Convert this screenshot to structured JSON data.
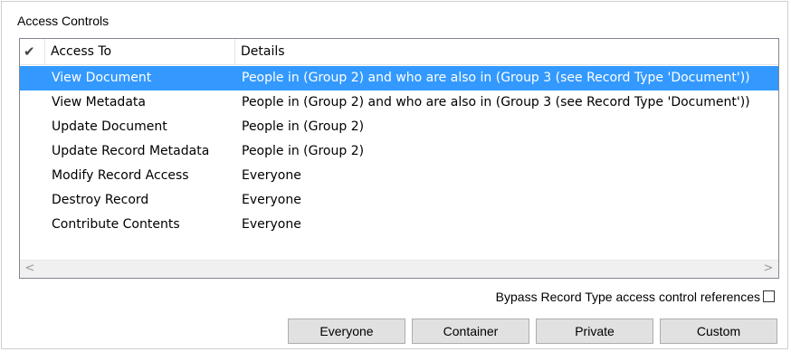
{
  "group": {
    "title": "Access Controls"
  },
  "list": {
    "headers": {
      "check": "✔",
      "access": "Access To",
      "details": "Details"
    },
    "selected_color": "#3399ff",
    "rows": [
      {
        "access": "View Document",
        "details": "People in (Group 2) and who are also in (Group 3 (see Record Type 'Document'))",
        "selected": true
      },
      {
        "access": "View Metadata",
        "details": "People in (Group 2) and who are also in (Group 3 (see Record Type 'Document'))"
      },
      {
        "access": "Update Document",
        "details": "People in (Group 2)"
      },
      {
        "access": "Update Record Metadata",
        "details": "People in (Group 2)"
      },
      {
        "access": "Modify Record Access",
        "details": "Everyone"
      },
      {
        "access": "Destroy Record",
        "details": "Everyone"
      },
      {
        "access": "Contribute Contents",
        "details": "Everyone"
      }
    ],
    "scroll": {
      "left_icon": "chevron-left-icon",
      "right_icon": "chevron-right-icon",
      "left_glyph": "<",
      "right_glyph": ">"
    }
  },
  "bypass": {
    "label": "Bypass Record Type access control references",
    "checked": false
  },
  "buttons": {
    "everyone": "Everyone",
    "container": "Container",
    "private": "Private",
    "custom": "Custom"
  }
}
